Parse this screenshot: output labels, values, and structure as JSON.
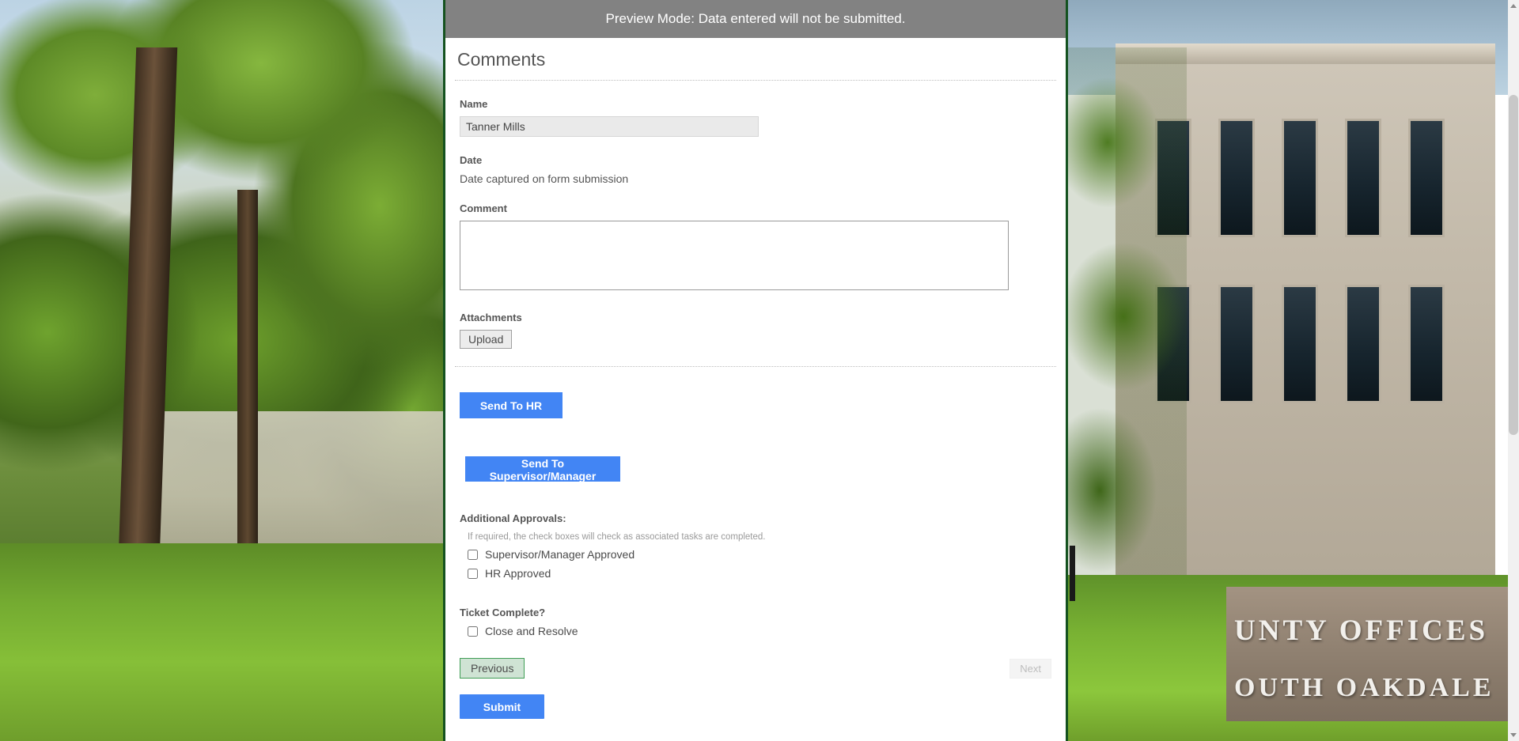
{
  "banner": {
    "message": "Preview Mode: Data entered will not be submitted."
  },
  "form": {
    "section_title": "Comments",
    "name": {
      "label": "Name",
      "value": "Tanner Mills",
      "placeholder": ""
    },
    "date": {
      "label": "Date",
      "value": "Date captured on form submission"
    },
    "comment": {
      "label": "Comment",
      "value": "",
      "placeholder": ""
    },
    "attachments": {
      "label": "Attachments",
      "upload_label": "Upload"
    },
    "actions": {
      "send_to_hr": "Send To HR",
      "send_to_supervisor": "Send To Supervisor/Manager"
    },
    "approvals": {
      "title": "Additional Approvals:",
      "helper": "If required, the check boxes will check as associated tasks are completed.",
      "items": [
        {
          "label": "Supervisor/Manager Approved",
          "checked": false
        },
        {
          "label": "HR Approved",
          "checked": false
        }
      ]
    },
    "ticket": {
      "title": "Ticket Complete?",
      "items": [
        {
          "label": "Close and Resolve",
          "checked": false
        }
      ]
    },
    "navigation": {
      "previous": "Previous",
      "next": "Next",
      "submit": "Submit"
    }
  },
  "background": {
    "sign_line1": "UNTY OFFICES",
    "sign_line2": "OUTH OAKDALE"
  },
  "colors": {
    "banner_bg": "#828282",
    "primary_button": "#4285f4",
    "previous_button": "#cfe3d4",
    "previous_border": "#3f9d55",
    "input_bg": "#eaeaea",
    "frame_border": "#14521f"
  }
}
